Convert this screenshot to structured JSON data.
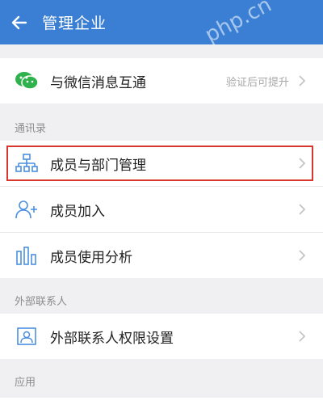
{
  "header": {
    "title": "管理企业",
    "watermark": "php.cn"
  },
  "wechat_row": {
    "label": "与微信消息互通",
    "hint": "验证后可提升"
  },
  "contacts_section": {
    "title": "通讯录",
    "items": [
      {
        "label": "成员与部门管理",
        "icon": "org-chart-icon"
      },
      {
        "label": "成员加入",
        "icon": "add-user-icon"
      },
      {
        "label": "成员使用分析",
        "icon": "bar-chart-icon"
      }
    ]
  },
  "external_section": {
    "title": "外部联系人",
    "items": [
      {
        "label": "外部联系人权限设置",
        "icon": "contact-card-icon"
      }
    ]
  },
  "apps_section": {
    "title": "应用"
  },
  "colors": {
    "header_bg": "#3a7fd4",
    "icon_blue": "#4a8fe0",
    "wechat_green": "#2fb24c",
    "highlight_red": "#d7372d"
  }
}
